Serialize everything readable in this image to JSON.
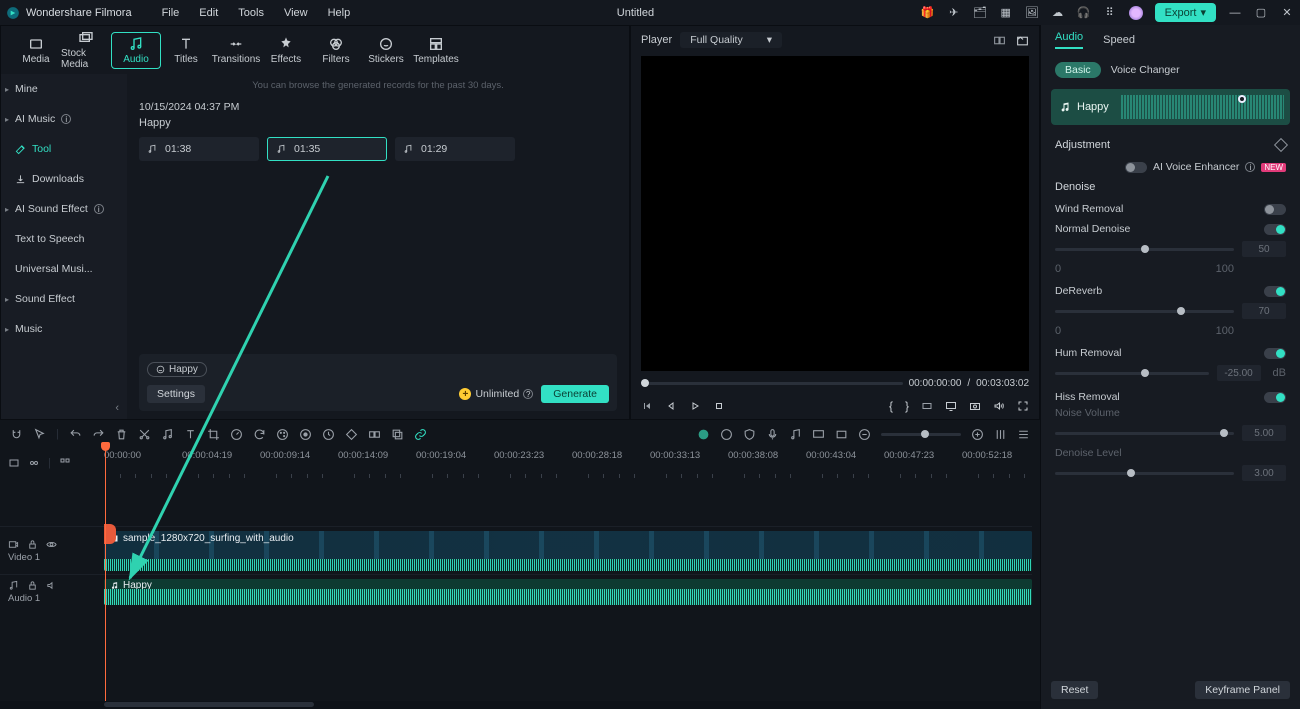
{
  "app": {
    "name": "Wondershare Filmora",
    "document": "Untitled"
  },
  "menu": [
    "File",
    "Edit",
    "Tools",
    "View",
    "Help"
  ],
  "export_label": "Export",
  "tabs": [
    {
      "label": "Media"
    },
    {
      "label": "Stock Media"
    },
    {
      "label": "Audio"
    },
    {
      "label": "Titles"
    },
    {
      "label": "Transitions"
    },
    {
      "label": "Effects"
    },
    {
      "label": "Filters"
    },
    {
      "label": "Stickers"
    },
    {
      "label": "Templates"
    }
  ],
  "active_tab": 2,
  "sidebar": {
    "items": [
      {
        "label": "Mine",
        "chev": true
      },
      {
        "label": "AI Music",
        "chev": true,
        "info": true
      },
      {
        "label": "Tool",
        "sel": true,
        "icon": "wand"
      },
      {
        "label": "Downloads",
        "icon": "download"
      },
      {
        "label": "AI Sound Effect",
        "chev": true,
        "info": true
      },
      {
        "label": "Text to Speech"
      },
      {
        "label": "Universal Musi..."
      },
      {
        "label": "Sound Effect",
        "chev": true
      },
      {
        "label": "Music",
        "chev": true
      }
    ]
  },
  "content": {
    "hint": "You can browse the generated records for the past 30 days.",
    "date": "10/15/2024 04:37 PM",
    "name": "Happy",
    "clips": [
      {
        "dur": "01:38"
      },
      {
        "dur": "01:35",
        "sel": true
      },
      {
        "dur": "01:29"
      }
    ],
    "tag": "Happy",
    "settings": "Settings",
    "unlimited": "Unlimited",
    "generate": "Generate"
  },
  "preview": {
    "player_label": "Player",
    "quality": "Full Quality",
    "cur": "00:00:00:00",
    "dur": "00:03:03:02",
    "sep": "/"
  },
  "inspector": {
    "tabs": [
      "Audio",
      "Speed"
    ],
    "subtabs": [
      "Basic",
      "Voice Changer"
    ],
    "clip_name": "Happy",
    "adjustment": "Adjustment",
    "ai_enh": "AI Voice Enhancer",
    "new": "NEW",
    "denoise": "Denoise",
    "wind": "Wind Removal",
    "normal": "Normal Denoise",
    "normal_val": "50",
    "dereverb": "DeReverb",
    "dereverb_val": "70",
    "hum": "Hum Removal",
    "hum_val": "-25.00",
    "hum_unit": "dB",
    "hiss": "Hiss Removal",
    "hiss_sub1": "Noise Volume",
    "hiss_v1": "5.00",
    "hiss_sub2": "Denoise Level",
    "hiss_v2": "3.00",
    "scale_lo": "0",
    "scale_hi": "100",
    "reset": "Reset",
    "kf": "Keyframe Panel"
  },
  "timeline": {
    "ticks": [
      "00:00:00",
      "00:00:04:19",
      "00:00:09:14",
      "00:00:14:09",
      "00:00:19:04",
      "00:00:23:23",
      "00:00:28:18",
      "00:00:33:13",
      "00:00:38:08",
      "00:00:43:04",
      "00:00:47:23",
      "00:00:52:18"
    ],
    "video_track": "Video 1",
    "audio_track": "Audio 1",
    "video_clip": "sample_1280x720_surfing_with_audio",
    "audio_clip": "Happy"
  }
}
